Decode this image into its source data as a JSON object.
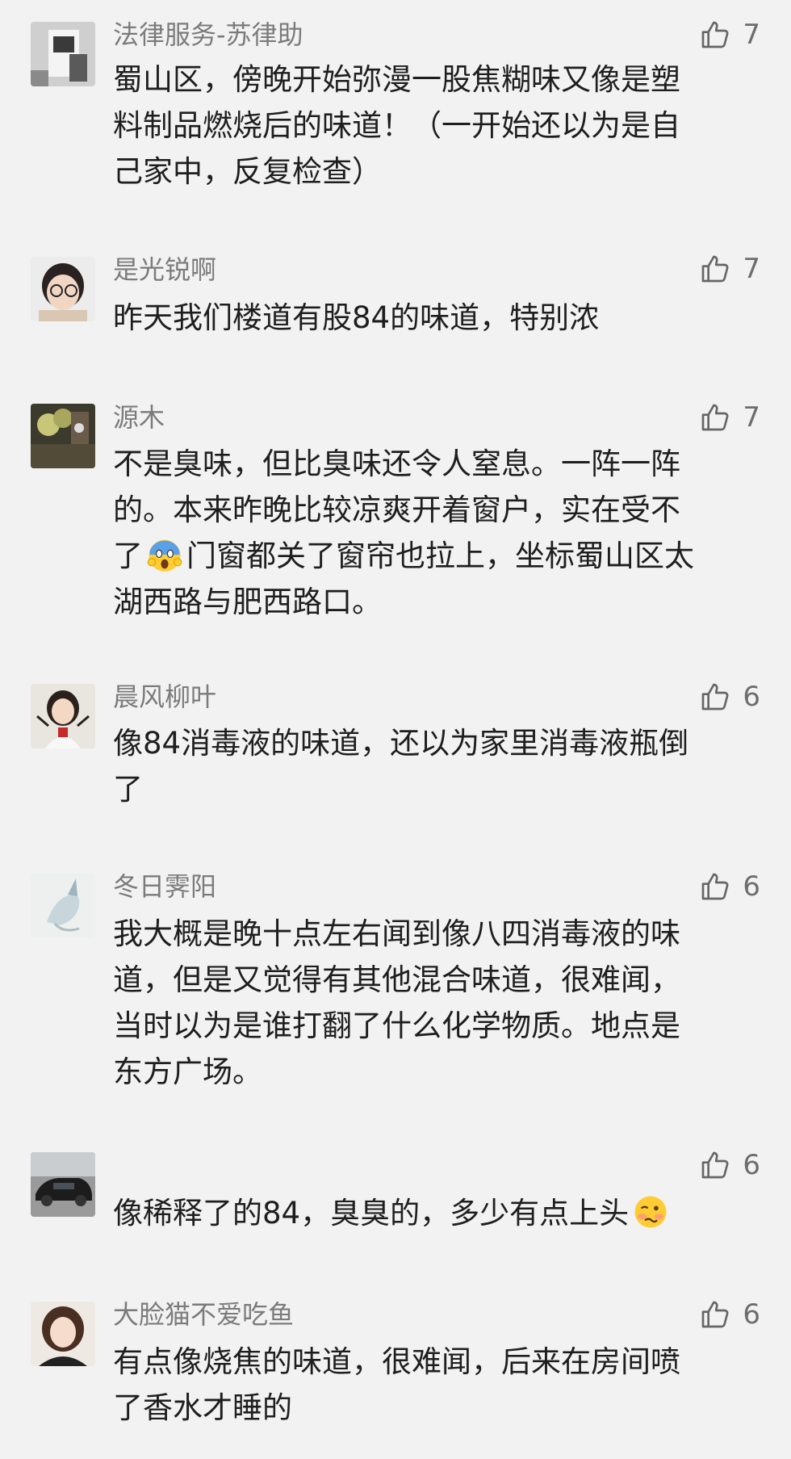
{
  "comments": [
    {
      "user": "法律服务-苏律助",
      "likes": "7",
      "lines": [
        "蜀山区，傍晚开始弥漫一股焦糊味又像是塑",
        "料制品燃烧后的味道！（一开始还以为是自",
        "己家中，反复检查）"
      ]
    },
    {
      "user": "是光锐啊",
      "likes": "7",
      "lines": [
        "昨天我们楼道有股84的味道，特别浓"
      ]
    },
    {
      "user": "源木",
      "likes": "7",
      "lines": [
        "不是臭味，但比臭味还令人窒息。一阵一阵",
        "的。本来昨晚比较凉爽开着窗户，实在受不"
      ],
      "emoji_line": {
        "before": "了",
        "emoji": "screaming-face-emoji",
        "after": "门窗都关了窗帘也拉上，坐标蜀山区太"
      },
      "lines_after": [
        "湖西路与肥西路口。"
      ]
    },
    {
      "user": "晨风柳叶",
      "likes": "6",
      "lines": [
        "像84消毒液的味道，还以为家里消毒液瓶倒",
        "了"
      ]
    },
    {
      "user": "冬日霁阳",
      "likes": "6",
      "lines": [
        "我大概是晚十点左右闻到像八四消毒液的味",
        "道，但是又觉得有其他混合味道，很难闻，",
        "当时以为是谁打翻了什么化学物质。地点是",
        "东方广场。"
      ]
    },
    {
      "user": "",
      "likes": "6",
      "emoji_line": {
        "before": "像稀释了的84，臭臭的，多少有点上头",
        "emoji": "woozy-face-emoji",
        "after": ""
      }
    },
    {
      "user": "大脸猫不爱吃鱼",
      "likes": "6",
      "lines": [
        "有点像烧焦的味道，很难闻，后来在房间喷",
        "了香水才睡的"
      ]
    }
  ]
}
